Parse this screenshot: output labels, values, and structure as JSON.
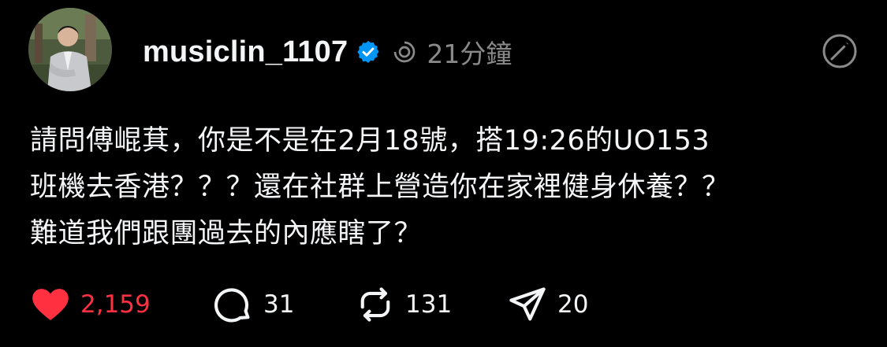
{
  "post": {
    "username": "musiclin_1107",
    "time": "21分鐘",
    "text": "請問傅崐萁，你是不是在2月18號，搭19:26的UO153\n班機去香港？？？還在社群上營造你在家裡健身休養？？\n難道我們跟團過去的內應瞎了？"
  },
  "actions": {
    "likes": "2,159",
    "replies": "31",
    "reposts": "131",
    "shares": "20"
  },
  "icons": {
    "avatar": "avatar-photo",
    "verified": "verified-badge-icon",
    "threads": "threads-ring-icon",
    "more": "edit-circle-icon",
    "like": "heart-icon",
    "reply": "comment-bubble-icon",
    "repost": "repost-icon",
    "share": "send-icon"
  },
  "colors": {
    "background": "#000000",
    "text": "#f3f5f7",
    "muted": "#8a8a8a",
    "like": "#ff3040",
    "verified": "#0095f6"
  }
}
